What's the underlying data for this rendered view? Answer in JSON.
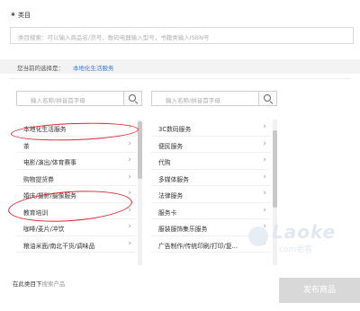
{
  "header": {
    "required_mark": "✱",
    "title": "类目"
  },
  "category_search": {
    "placeholder": "类目搜索：可以输入商品名/货号，数码电器输入型号，书籍类输入ISBN号"
  },
  "selected": {
    "label": "您当前的选择是：",
    "value": "本地化生活服务"
  },
  "left_column": {
    "search_placeholder": "输入名称/拼音首字母",
    "items": [
      {
        "label": "本地化生活服务"
      },
      {
        "label": "茶"
      },
      {
        "label": "电影/演出/体育赛事"
      },
      {
        "label": "购物提货券"
      },
      {
        "label": "婚庆/摄影/摄像服务"
      },
      {
        "label": "教育培训"
      },
      {
        "label": "咖啡/麦片/冲饮"
      },
      {
        "label": "粮油米面/南北干货/调味品"
      }
    ]
  },
  "right_column": {
    "search_placeholder": "输入名称/拼音首字母",
    "items": [
      {
        "label": "3C数码服务"
      },
      {
        "label": "便民服务"
      },
      {
        "label": "代购"
      },
      {
        "label": "多媒体服务"
      },
      {
        "label": "法律服务"
      },
      {
        "label": "服务卡"
      },
      {
        "label": "服装服饰集乐服务"
      },
      {
        "label": "广告制作/传统印刷/打印/复..."
      }
    ]
  },
  "footer": {
    "search_in_category_main": "在此类目下",
    "search_in_category_sub": "搜索产品",
    "publish_label": "发布商品"
  },
  "watermark": {
    "big": "Laoke",
    "small": "com老客"
  },
  "colors": {
    "link_blue": "#3a7bd5",
    "highlight_red": "#e0242c",
    "disabled_button": "#d8d8d8"
  }
}
